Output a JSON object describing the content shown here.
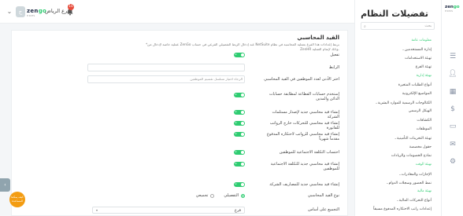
{
  "header": {
    "branch": "فرع الرياض",
    "notifications_count": "10",
    "avatar_letter": "ج",
    "logo_main": "zen",
    "logo_accent": "go",
    "logo_sub": "HRMS"
  },
  "content": {
    "section_title": "القيد المحاسبي",
    "section_description": "*عملية خاصة لإدخال من ZenGo عند إدخال الربط التفصيلي الفرعي في حساب NetSuite بربط إعدادات هذا الفرع بعملية المحاسبة في نظام ZenHR وذلك لإتمام العملية.",
    "toggle_on_label": "on",
    "rows": {
      "enable": "تفعيل",
      "link": "الرابط",
      "allocation_type": "اختر الأدنى لعدد الموظفين في القيد المحاسبي",
      "split_accounts": "إستخدم حسابات الفطاعة لمطابقة حسابات الدائن والمدين",
      "entry_per_dept": "إنشاء قيد محاسبي جديد لإصدار مستلمات الشركة",
      "entry_outside": "إنشاء قيد محاسبي للتحركات خارج الرواتب للفاتورة",
      "entry_advance": "إنشاء قيد محاسبي للرواتب لاحتكاره المدفوع مقدماً شهرياً",
      "total_cost": "احتساب التكلفة الاجتماعية للموظفين",
      "entry_social_cost": "إنشاء قيد محاسبي جديد للتكلفة الاجتماعية للموظفين",
      "entry_expenses": "إنشاء قيد محاسبي جديد للمصاريف الشركة",
      "entry_type": "نوع القيد المحاسبي",
      "group_by": "التجميع على أساس"
    },
    "link_placeholder": "",
    "allocation_placeholder": "الرجاء اختيار تسلسل تقسيم الموظفين",
    "entry_type_options": [
      "التفصيلي",
      "تجميعي"
    ],
    "group_by_value": "فرع"
  },
  "sidebar": {
    "title": "تفضيلات النظام",
    "search_placeholder": "بحث",
    "items": [
      {
        "label": "معلومات عامة",
        "cat": true
      },
      {
        "label": "إدارة المستخدمين",
        "chev": true
      },
      {
        "label": "تهيئة الاستخدامات"
      },
      {
        "label": "تهيئة الفرع"
      },
      {
        "label": "تهيئة إدارية",
        "cat": true
      },
      {
        "label": "أنواع الطلبات المتغيرة"
      },
      {
        "label": "المواضيع الإلكترونية"
      },
      {
        "label": "الكتالوجات الرسمية للموارد البشرية",
        "chev": true
      },
      {
        "label": "الهيكل الرسمي"
      },
      {
        "label": "الكشافات"
      },
      {
        "label": "الموظفات"
      },
      {
        "label": "تهيئة التخزينات التأمينية",
        "chev": true
      },
      {
        "label": "حقول مخصصة"
      },
      {
        "label": "نماذج الخصومات والزيادات"
      },
      {
        "label": "تهيئة الوقت",
        "cat": true
      },
      {
        "label": "الإجازات والمغادرات",
        "chev": true
      },
      {
        "label": "نمط الحضور وسجلات الدوام",
        "chev": true
      },
      {
        "label": "تهيئة مالية",
        "cat": true
      },
      {
        "label": "أنواع التحركات المالية",
        "chev": true
      },
      {
        "label": "إعدادات راتب الاحتكاره المدفوع مسبقاً"
      }
    ]
  },
  "rail": {
    "logo_main": "zen",
    "logo_accent": "go",
    "logo_sub": "HRMS",
    "icons": [
      "menu-icon",
      "user-icon",
      "calendar-icon",
      "dollar-icon",
      "folder-icon",
      "chat-icon",
      "gear-icon"
    ]
  },
  "help": {
    "label": "كيف يمكننا المساعدة"
  }
}
